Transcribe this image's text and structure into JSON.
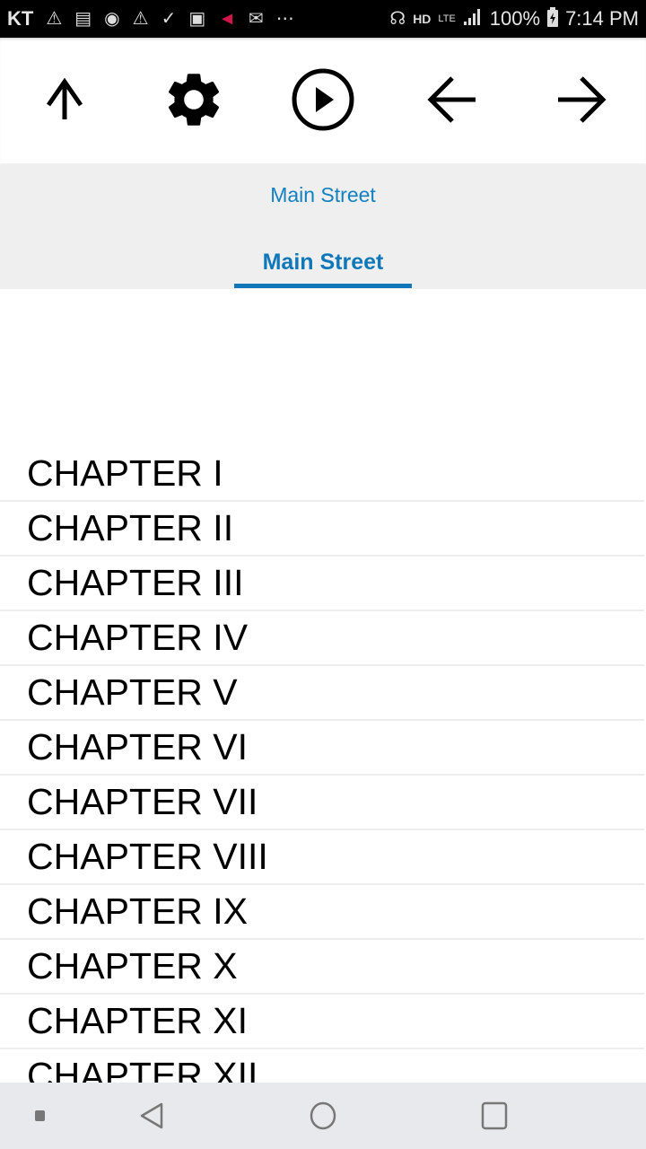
{
  "status_bar": {
    "carrier": "KT",
    "left_icons": [
      "warning-icon",
      "news-icon",
      "firefox-icon",
      "warning-icon",
      "download-done-icon",
      "maps-icon",
      "megaphone-icon",
      "gmail-icon",
      "more-icon"
    ],
    "right_icons": [
      "headphones-icon",
      "hd-voice-icon",
      "lte-icon",
      "signal-icon"
    ],
    "battery": "100%",
    "time": "7:14 PM"
  },
  "toolbar": {
    "buttons": [
      {
        "name": "up-button",
        "icon": "arrow-up-icon"
      },
      {
        "name": "settings-button",
        "icon": "gear-icon"
      },
      {
        "name": "play-button",
        "icon": "play-circle-icon"
      },
      {
        "name": "back-button",
        "icon": "arrow-left-icon"
      },
      {
        "name": "forward-button",
        "icon": "arrow-right-icon"
      }
    ]
  },
  "header": {
    "title": "Main Street",
    "tab_label": "Main Street",
    "accent_color": "#1078b8"
  },
  "chapters": [
    "CHAPTER I",
    "CHAPTER II",
    "CHAPTER III",
    "CHAPTER IV",
    "CHAPTER V",
    "CHAPTER VI",
    "CHAPTER VII",
    "CHAPTER VIII",
    "CHAPTER IX",
    "CHAPTER X",
    "CHAPTER XI",
    "CHAPTER XII"
  ],
  "nav_bar": {
    "buttons": [
      "indicator",
      "back",
      "home",
      "recents"
    ]
  }
}
